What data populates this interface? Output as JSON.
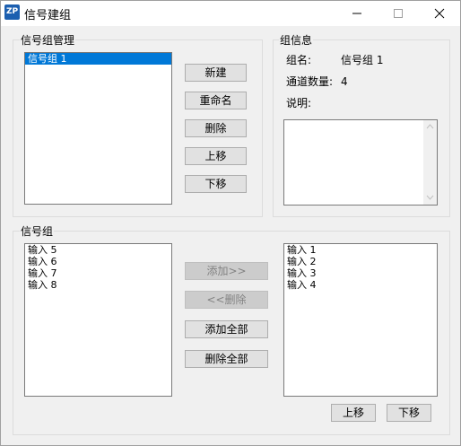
{
  "window": {
    "title": "信号建组",
    "icon_text": "ZP"
  },
  "group_manage": {
    "legend": "信号组管理",
    "items": [
      {
        "label": "信号组 1",
        "selected": true
      }
    ],
    "buttons": {
      "new": "新建",
      "rename": "重命名",
      "delete": "删除",
      "up": "上移",
      "down": "下移"
    }
  },
  "group_info": {
    "legend": "组信息",
    "name_label": "组名:",
    "name_value": "信号组 1",
    "channel_label": "通道数量:",
    "channel_value": "4",
    "desc_label": "说明:",
    "desc_value": ""
  },
  "signal_group": {
    "legend": "信号组",
    "available": [
      "输入 5",
      "输入 6",
      "输入 7",
      "输入 8"
    ],
    "selected": [
      "输入 1",
      "输入 2",
      "输入 3",
      "输入 4"
    ],
    "buttons": {
      "add": "添加>>",
      "remove": "<<删除",
      "add_all": "添加全部",
      "remove_all": "删除全部",
      "up": "上移",
      "down": "下移"
    }
  }
}
